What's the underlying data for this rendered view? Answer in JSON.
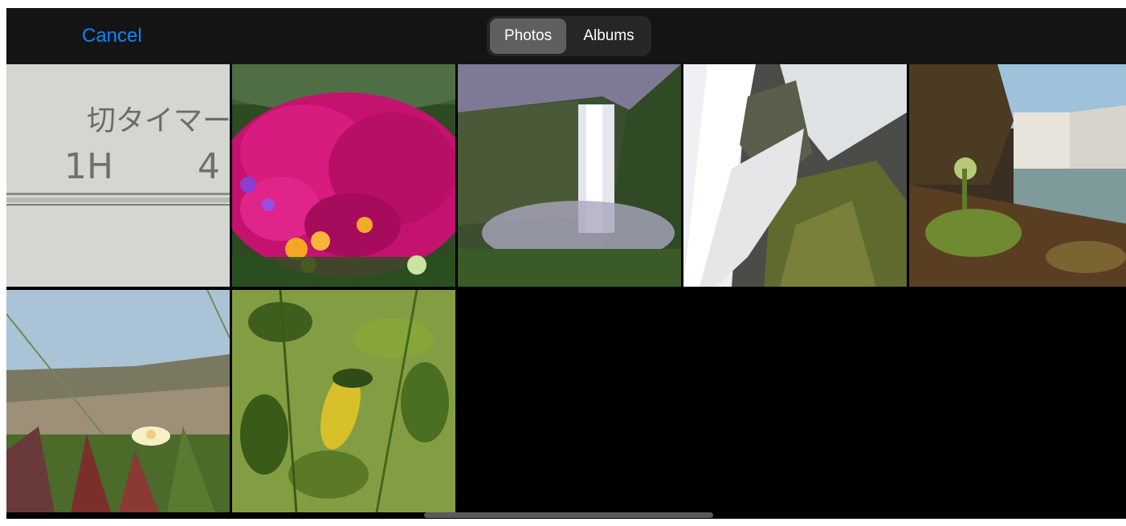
{
  "navbar": {
    "cancel_label": "Cancel",
    "tabs": [
      {
        "label": "Photos",
        "selected": true
      },
      {
        "label": "Albums",
        "selected": false
      }
    ]
  },
  "photos": [
    {
      "name": "photo-timer-label",
      "text_line1": "切タイマー",
      "text_line2": "1H",
      "text_line3": "4"
    },
    {
      "name": "photo-pink-flowers"
    },
    {
      "name": "photo-waterfall-cliff"
    },
    {
      "name": "photo-waterfall-mossy-rocks"
    },
    {
      "name": "photo-waterfall-sunset"
    },
    {
      "name": "photo-ice-plant-flower"
    },
    {
      "name": "photo-lemon-leaves"
    }
  ],
  "colors": {
    "accent": "#0a84ff",
    "navbar_bg": "#141414",
    "segment_bg": "#262626",
    "segment_selected": "#5f5f61"
  }
}
